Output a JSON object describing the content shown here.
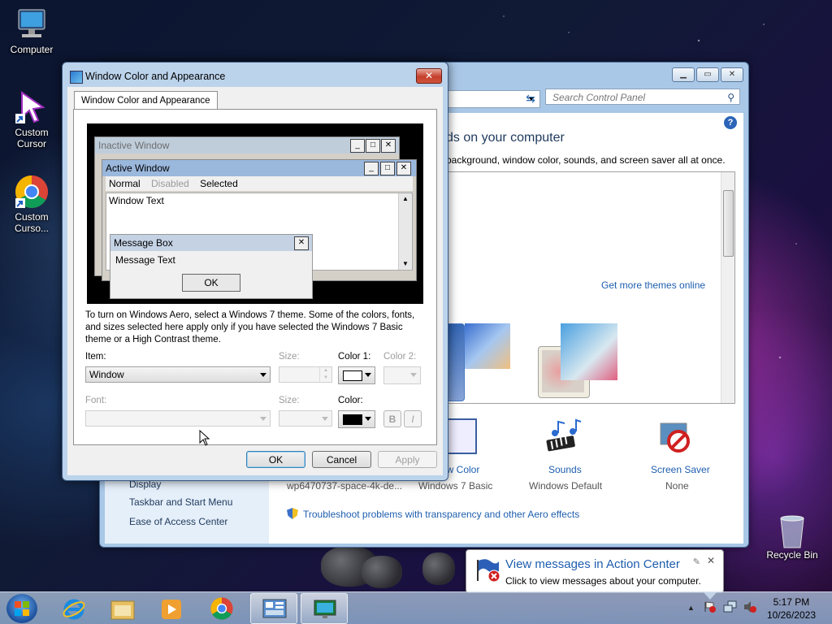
{
  "desktop": {
    "icons": [
      {
        "label": "Computer"
      },
      {
        "label": "Custom Cursor"
      },
      {
        "label": "Custom Curso..."
      },
      {
        "label": "Recycle Bin"
      }
    ]
  },
  "control_panel": {
    "search_placeholder": "Search Control Panel",
    "heading": "ds on your computer",
    "subheading": "background, window color, sounds, and screen saver all at once.",
    "get_more_themes": "Get more themes online",
    "bottom_items": [
      {
        "title": "ow Color",
        "subtitle": "Windows 7 Basic"
      },
      {
        "title": "Sounds",
        "subtitle": "Windows Default"
      },
      {
        "title": "Screen Saver",
        "subtitle": "None"
      }
    ],
    "desktop_bg_name": "wp6470737-space-4k-de...",
    "troubleshoot_link": "Troubleshoot problems with transparency and other Aero effects",
    "left_nav": [
      "Display",
      "Taskbar and Start Menu",
      "Ease of Access Center"
    ]
  },
  "dialog": {
    "title": "Window Color and Appearance",
    "tab_label": "Window Color and Appearance",
    "preview": {
      "inactive_title": "Inactive Window",
      "active_title": "Active Window",
      "menu_normal": "Normal",
      "menu_disabled": "Disabled",
      "menu_selected": "Selected",
      "window_text": "Window Text",
      "msgbox_title": "Message Box",
      "msgbox_text": "Message Text",
      "msgbox_ok": "OK"
    },
    "description": "To turn on Windows Aero, select a Windows 7 theme.  Some of the colors, fonts, and sizes selected here apply only if you have selected the Windows 7 Basic theme or a High Contrast theme.",
    "item_label": "Item:",
    "item_value": "Window",
    "size_label": "Size:",
    "color1_label": "Color 1:",
    "color2_label": "Color 2:",
    "font_label": "Font:",
    "font_size_label": "Size:",
    "font_color_label": "Color:",
    "bold_label": "B",
    "italic_label": "I",
    "ok": "OK",
    "cancel": "Cancel",
    "apply": "Apply"
  },
  "toast": {
    "title": "View messages in Action Center",
    "text": "Click to view messages about your computer."
  },
  "taskbar": {
    "time": "5:17 PM",
    "date": "10/26/2023"
  },
  "colors": {
    "link": "#1e5eae",
    "dialog_frame": "#bcd3ec",
    "close_red": "#c4402d"
  }
}
